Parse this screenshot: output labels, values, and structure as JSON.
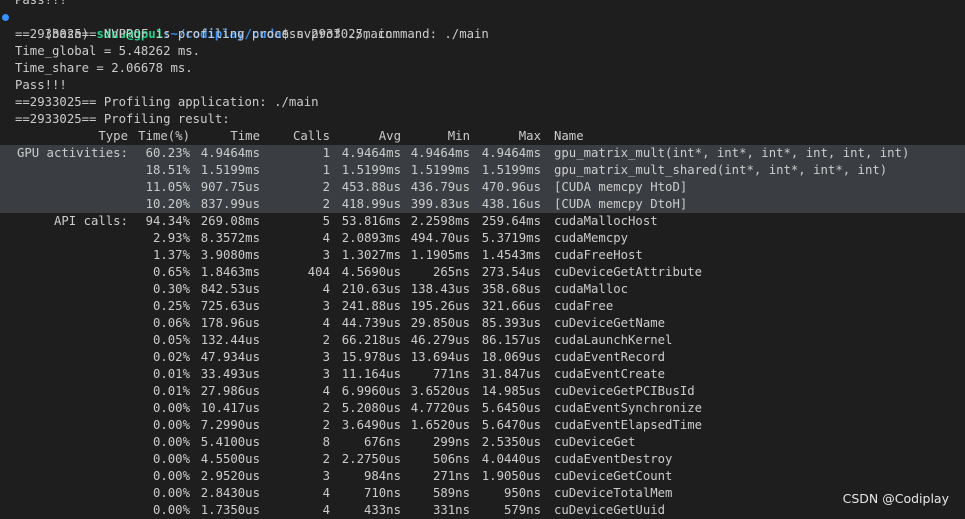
{
  "terminal": {
    "first_line": "Pass!!!",
    "prompt": {
      "env": "(base)",
      "user_host": "sdnu@gpu1",
      "path": ":~/codiplay/cuda",
      "symbol": "$",
      "command": "nvprof ./main"
    },
    "output": [
      "==2933025== NVPROF is profiling process 2933025, command: ./main",
      "Time_global = 5.48262 ms.",
      "Time_share = 2.06678 ms.",
      "Pass!!!",
      "==2933025== Profiling application: ./main",
      "==2933025== Profiling result:"
    ]
  },
  "profile": {
    "headers": [
      "Type",
      "Time(%)",
      "Time",
      "Calls",
      "Avg",
      "Min",
      "Max",
      "Name"
    ],
    "gpu_rows": [
      {
        "type": "GPU activities:",
        "pct": "60.23%",
        "time": "4.9464ms",
        "calls": "1",
        "avg": "4.9464ms",
        "min": "4.9464ms",
        "max": "4.9464ms",
        "name": "gpu_matrix_mult(int*, int*, int*, int, int, int)"
      },
      {
        "type": "",
        "pct": "18.51%",
        "time": "1.5199ms",
        "calls": "1",
        "avg": "1.5199ms",
        "min": "1.5199ms",
        "max": "1.5199ms",
        "name": "gpu_matrix_mult_shared(int*, int*, int*, int)"
      },
      {
        "type": "",
        "pct": "11.05%",
        "time": "907.75us",
        "calls": "2",
        "avg": "453.88us",
        "min": "436.79us",
        "max": "470.96us",
        "name": "[CUDA memcpy HtoD]"
      },
      {
        "type": "",
        "pct": "10.20%",
        "time": "837.99us",
        "calls": "2",
        "avg": "418.99us",
        "min": "399.83us",
        "max": "438.16us",
        "name": "[CUDA memcpy DtoH]"
      }
    ],
    "api_rows": [
      {
        "type": "API calls:",
        "pct": "94.34%",
        "time": "269.08ms",
        "calls": "5",
        "avg": "53.816ms",
        "min": "2.2598ms",
        "max": "259.64ms",
        "name": "cudaMallocHost"
      },
      {
        "type": "",
        "pct": "2.93%",
        "time": "8.3572ms",
        "calls": "4",
        "avg": "2.0893ms",
        "min": "494.70us",
        "max": "5.3719ms",
        "name": "cudaMemcpy"
      },
      {
        "type": "",
        "pct": "1.37%",
        "time": "3.9080ms",
        "calls": "3",
        "avg": "1.3027ms",
        "min": "1.1905ms",
        "max": "1.4543ms",
        "name": "cudaFreeHost"
      },
      {
        "type": "",
        "pct": "0.65%",
        "time": "1.8463ms",
        "calls": "404",
        "avg": "4.5690us",
        "min": "265ns",
        "max": "273.54us",
        "name": "cuDeviceGetAttribute"
      },
      {
        "type": "",
        "pct": "0.30%",
        "time": "842.53us",
        "calls": "4",
        "avg": "210.63us",
        "min": "138.43us",
        "max": "358.68us",
        "name": "cudaMalloc"
      },
      {
        "type": "",
        "pct": "0.25%",
        "time": "725.63us",
        "calls": "3",
        "avg": "241.88us",
        "min": "195.26us",
        "max": "321.66us",
        "name": "cudaFree"
      },
      {
        "type": "",
        "pct": "0.06%",
        "time": "178.96us",
        "calls": "4",
        "avg": "44.739us",
        "min": "29.850us",
        "max": "85.393us",
        "name": "cuDeviceGetName"
      },
      {
        "type": "",
        "pct": "0.05%",
        "time": "132.44us",
        "calls": "2",
        "avg": "66.218us",
        "min": "46.279us",
        "max": "86.157us",
        "name": "cudaLaunchKernel"
      },
      {
        "type": "",
        "pct": "0.02%",
        "time": "47.934us",
        "calls": "3",
        "avg": "15.978us",
        "min": "13.694us",
        "max": "18.069us",
        "name": "cudaEventRecord"
      },
      {
        "type": "",
        "pct": "0.01%",
        "time": "33.493us",
        "calls": "3",
        "avg": "11.164us",
        "min": "771ns",
        "max": "31.847us",
        "name": "cudaEventCreate"
      },
      {
        "type": "",
        "pct": "0.01%",
        "time": "27.986us",
        "calls": "4",
        "avg": "6.9960us",
        "min": "3.6520us",
        "max": "14.985us",
        "name": "cuDeviceGetPCIBusId"
      },
      {
        "type": "",
        "pct": "0.00%",
        "time": "10.417us",
        "calls": "2",
        "avg": "5.2080us",
        "min": "4.7720us",
        "max": "5.6450us",
        "name": "cudaEventSynchronize"
      },
      {
        "type": "",
        "pct": "0.00%",
        "time": "7.2990us",
        "calls": "2",
        "avg": "3.6490us",
        "min": "1.6520us",
        "max": "5.6470us",
        "name": "cudaEventElapsedTime"
      },
      {
        "type": "",
        "pct": "0.00%",
        "time": "5.4100us",
        "calls": "8",
        "avg": "676ns",
        "min": "299ns",
        "max": "2.5350us",
        "name": "cuDeviceGet"
      },
      {
        "type": "",
        "pct": "0.00%",
        "time": "4.5500us",
        "calls": "2",
        "avg": "2.2750us",
        "min": "506ns",
        "max": "4.0440us",
        "name": "cudaEventDestroy"
      },
      {
        "type": "",
        "pct": "0.00%",
        "time": "2.9520us",
        "calls": "3",
        "avg": "984ns",
        "min": "271ns",
        "max": "1.9050us",
        "name": "cuDeviceGetCount"
      },
      {
        "type": "",
        "pct": "0.00%",
        "time": "2.8430us",
        "calls": "4",
        "avg": "710ns",
        "min": "589ns",
        "max": "950ns",
        "name": "cuDeviceTotalMem"
      },
      {
        "type": "",
        "pct": "0.00%",
        "time": "1.7350us",
        "calls": "4",
        "avg": "433ns",
        "min": "331ns",
        "max": "579ns",
        "name": "cuDeviceGetUuid"
      }
    ]
  },
  "watermark": "CSDN @Codiplay",
  "colors": {
    "background": "#1e1e1e",
    "text": "#cccccc",
    "user": "#23d18b",
    "path": "#3b8eea",
    "selection": "#3a3d41",
    "dot": "#3794ff"
  }
}
